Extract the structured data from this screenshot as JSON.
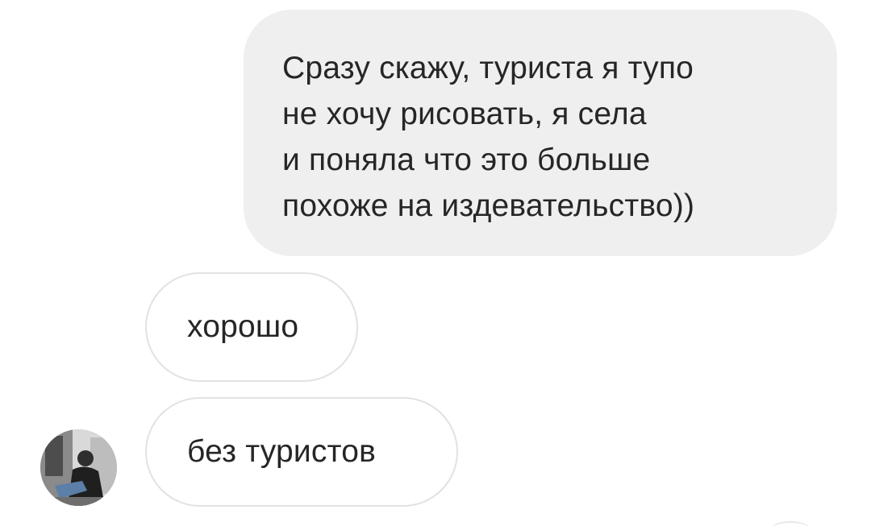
{
  "conversation": {
    "messages": [
      {
        "direction": "outgoing",
        "text": "Сразу скажу, туриста я тупо\nне хочу рисовать, я села\nи поняла что это больше\nпохоже на издевательство))"
      },
      {
        "direction": "incoming",
        "text": "хорошо"
      },
      {
        "direction": "incoming",
        "text": "без туристов"
      }
    ],
    "contact": {
      "avatar_icon": "user-photo-avatar"
    }
  },
  "colors": {
    "outgoing_bubble": "#efefef",
    "incoming_border": "#e2e2e2",
    "text": "#262626",
    "background": "#ffffff"
  }
}
